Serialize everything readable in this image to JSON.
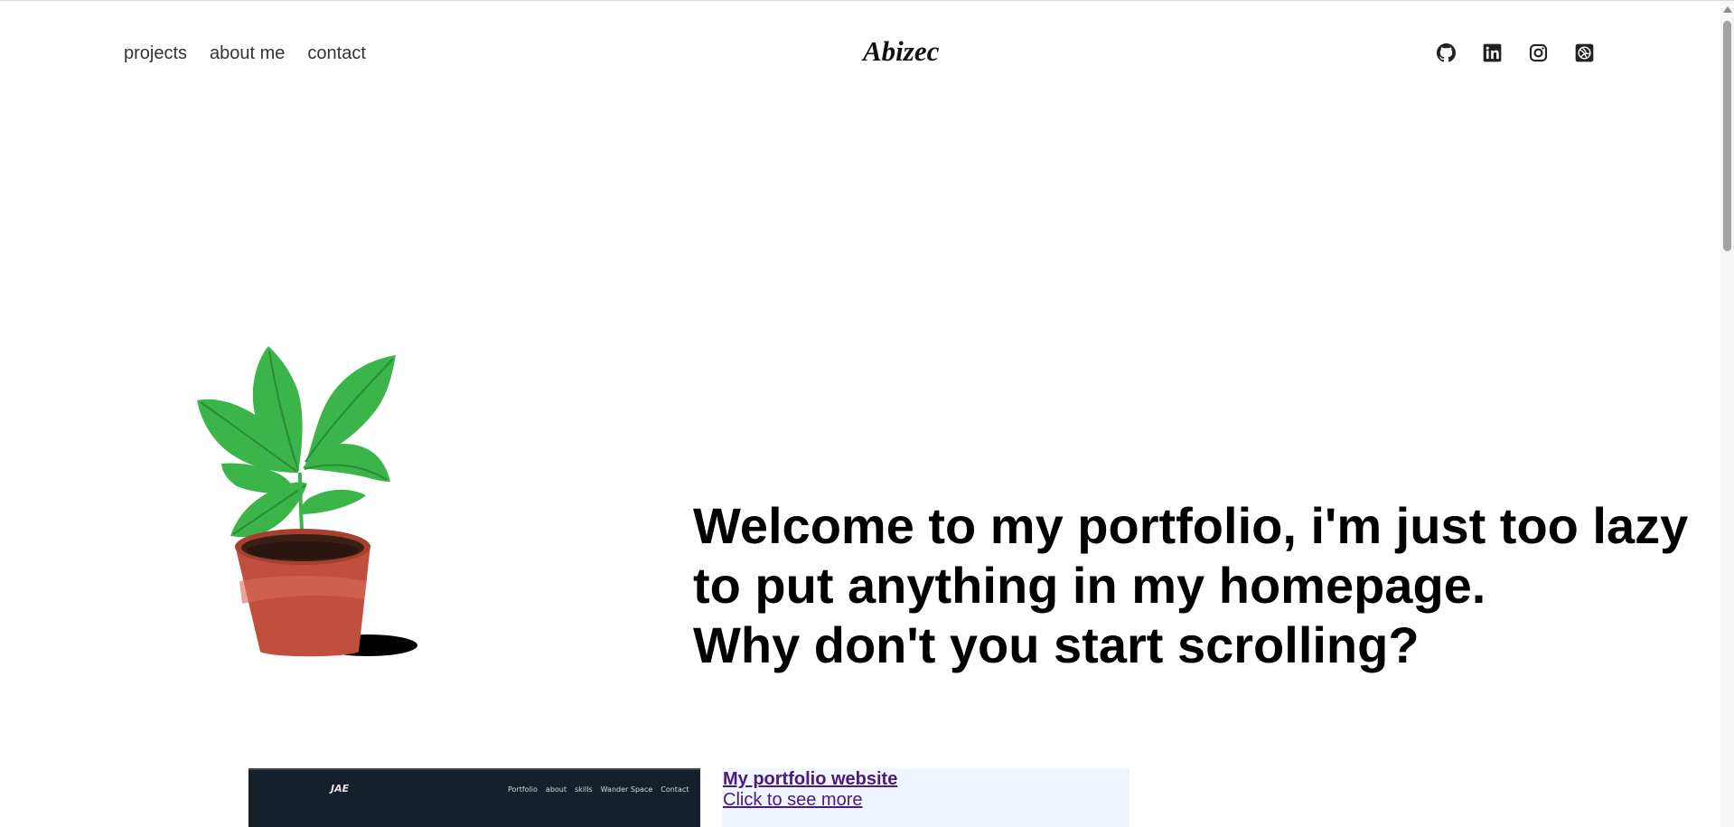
{
  "header": {
    "nav": [
      {
        "label": "projects"
      },
      {
        "label": "about me"
      },
      {
        "label": "contact"
      }
    ],
    "logo": "Abizec",
    "social_icons": [
      "github-icon",
      "linkedin-icon",
      "instagram-icon",
      "dribbble-icon"
    ]
  },
  "hero": {
    "lines": [
      "Welcome to my portfolio, i'm just too lazy",
      "to put anything in my homepage.",
      "Why don't you start scrolling?"
    ],
    "image": "potted-plant-illustration"
  },
  "project": {
    "thumb_logo": "JAE",
    "thumb_nav": [
      "Portfolio",
      "about",
      "skills",
      "Wander Space",
      "Contact"
    ],
    "title": "My portfolio website",
    "more": "Click to see more"
  },
  "colors": {
    "link_visited": "#4a1a80",
    "card_bg": "#eef5fd",
    "thumb_bg": "#16202b",
    "leaf": "#3bb54a",
    "pot": "#c0503d"
  }
}
